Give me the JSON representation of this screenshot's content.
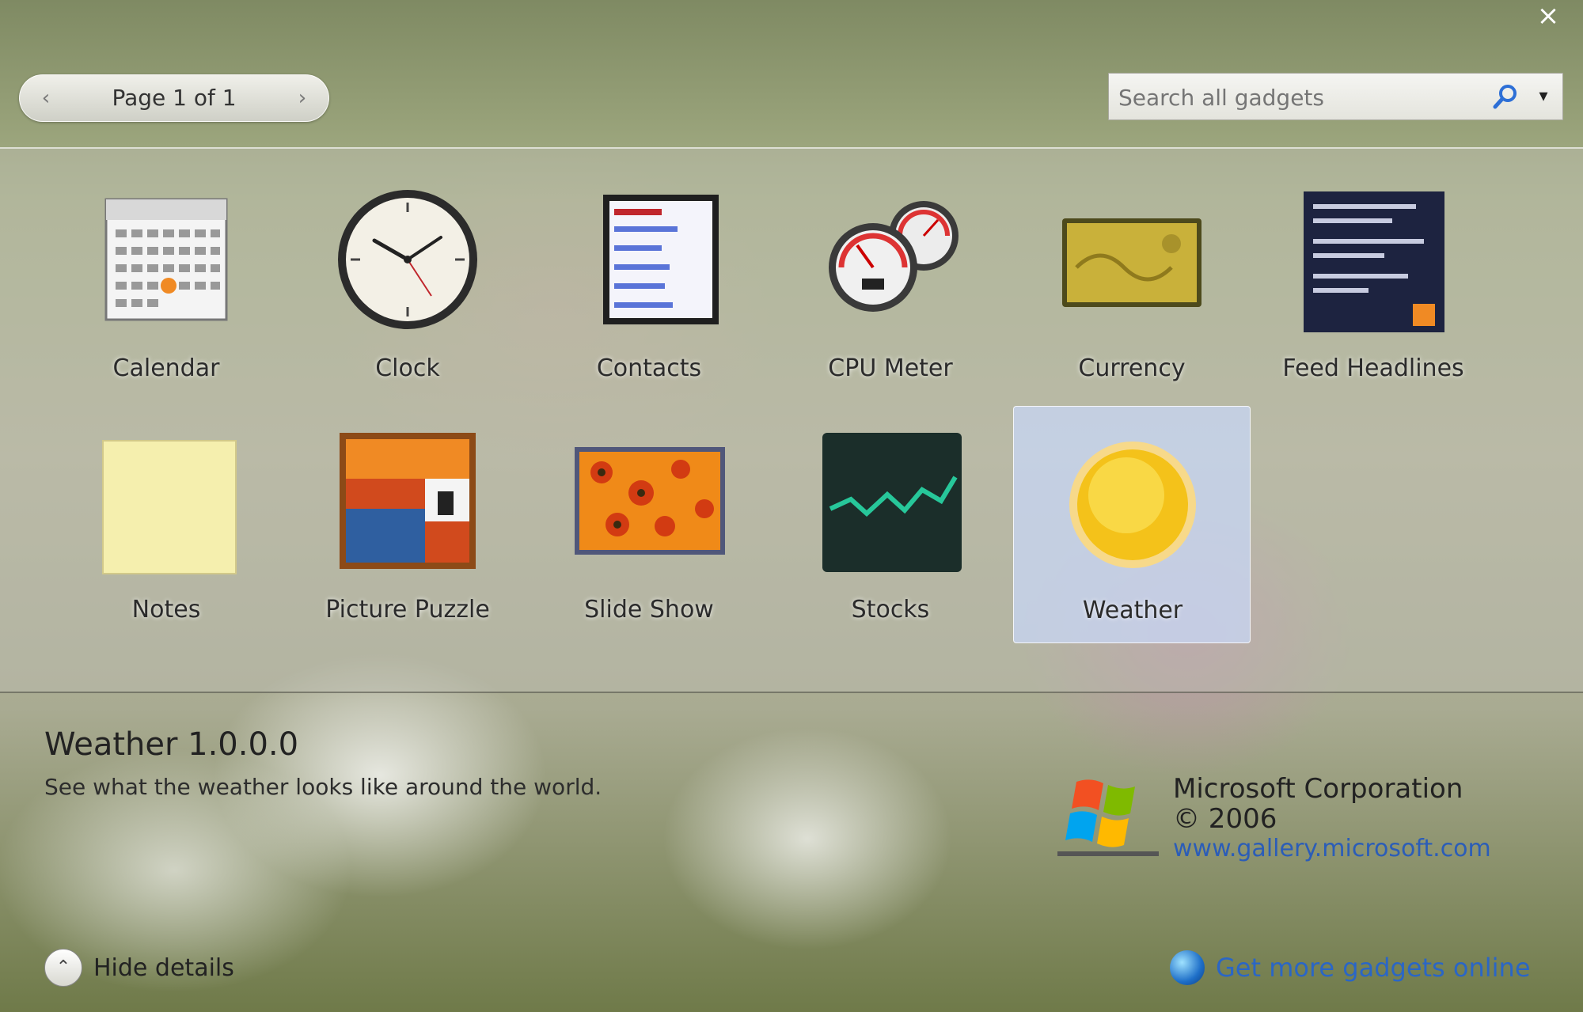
{
  "window": {
    "close_symbol": "×"
  },
  "pager": {
    "label": "Page 1 of 1",
    "prev_symbol": "‹",
    "next_symbol": "›"
  },
  "search": {
    "placeholder": "Search all gadgets",
    "dropdown_symbol": "▾"
  },
  "gadgets": [
    {
      "name": "Calendar",
      "icon": "calendar-icon"
    },
    {
      "name": "Clock",
      "icon": "clock-icon"
    },
    {
      "name": "Contacts",
      "icon": "contacts-icon"
    },
    {
      "name": "CPU Meter",
      "icon": "cpu-meter-icon"
    },
    {
      "name": "Currency",
      "icon": "currency-icon"
    },
    {
      "name": "Feed Headlines",
      "icon": "feed-headlines-icon"
    },
    {
      "name": "Notes",
      "icon": "notes-icon"
    },
    {
      "name": "Picture Puzzle",
      "icon": "picture-puzzle-icon"
    },
    {
      "name": "Slide Show",
      "icon": "slide-show-icon"
    },
    {
      "name": "Stocks",
      "icon": "stocks-icon"
    },
    {
      "name": "Weather",
      "icon": "weather-icon",
      "selected": true
    }
  ],
  "details": {
    "title": "Weather 1.0.0.0",
    "description": "See what the weather looks like around the world.",
    "publisher": "Microsoft Corporation",
    "copyright": "© 2006",
    "link": "www.gallery.microsoft.com"
  },
  "footer": {
    "hide_details_label": "Hide details",
    "hide_details_symbol": "⌃",
    "get_more_label": "Get more gadgets online"
  }
}
